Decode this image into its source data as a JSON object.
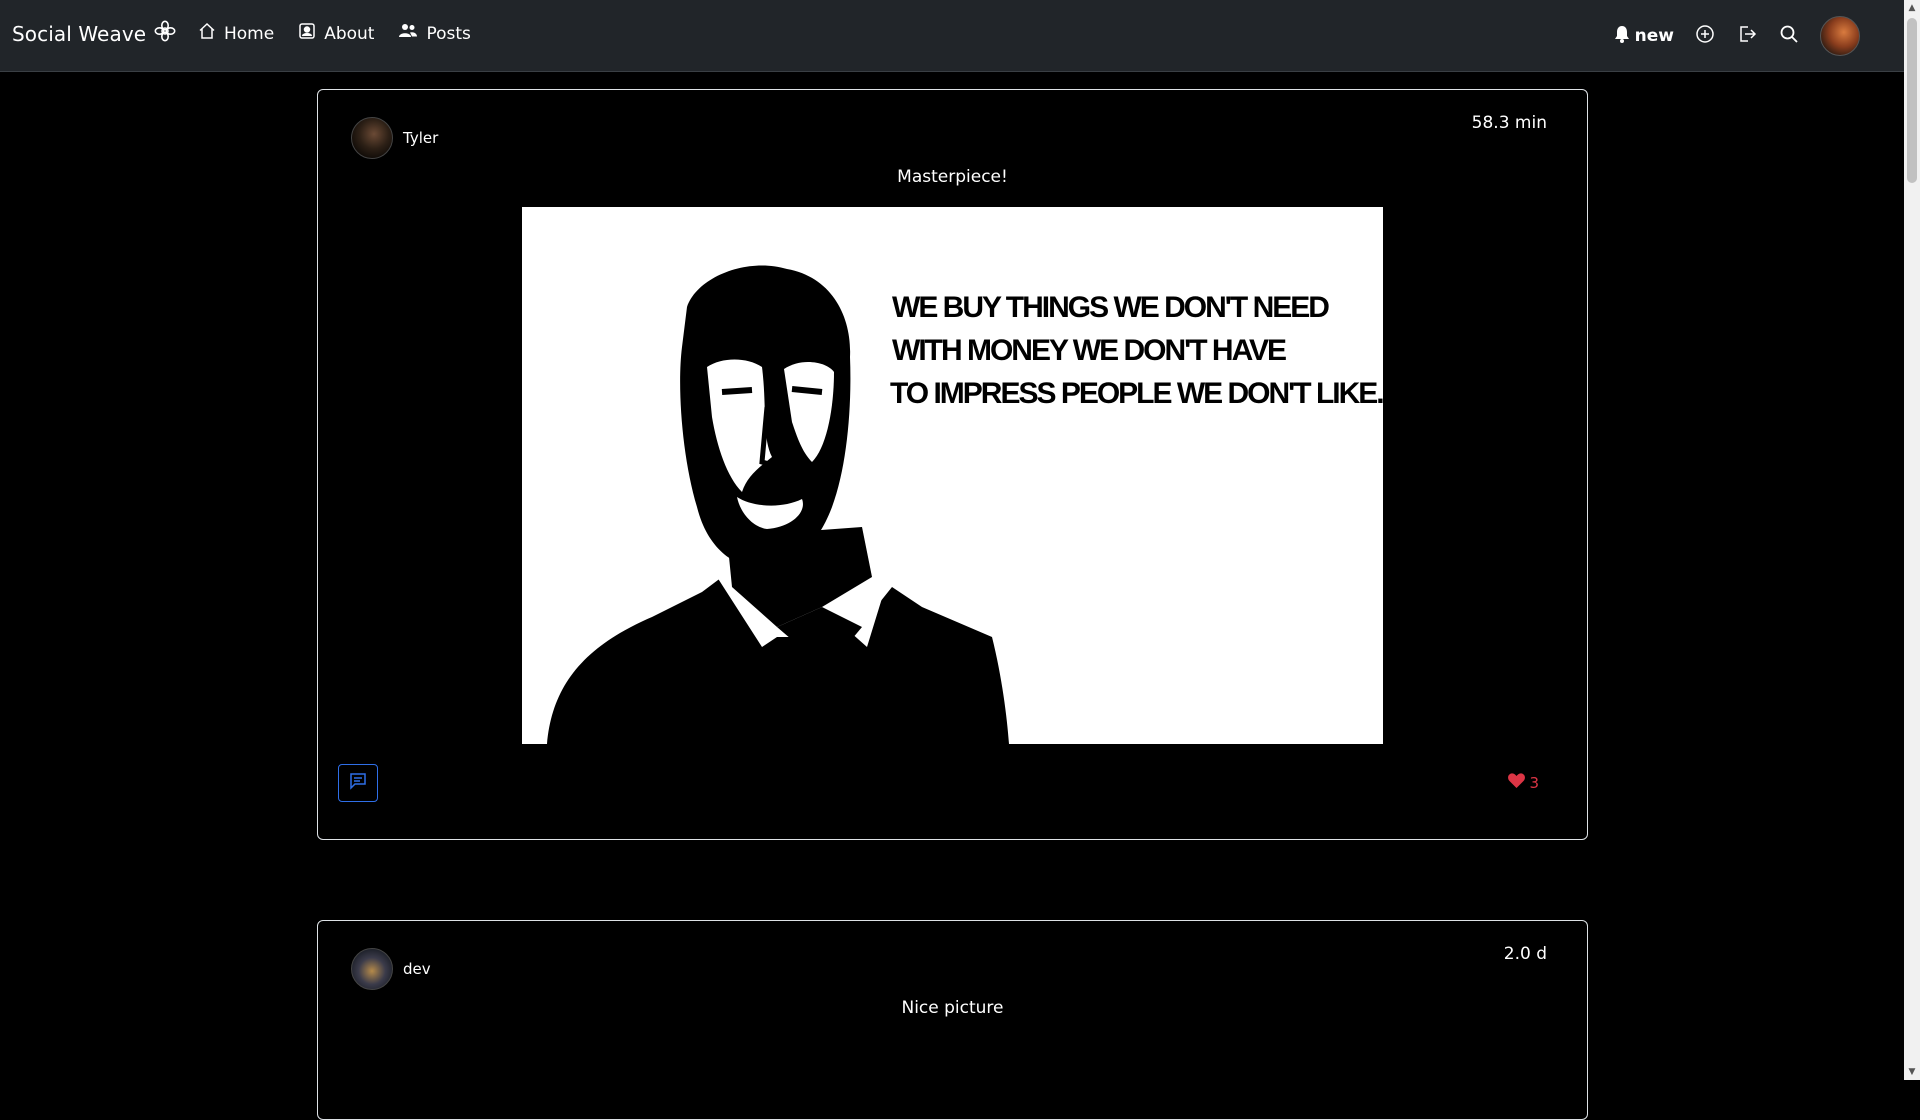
{
  "app": {
    "brand": "Social Weave",
    "brand_icon": "flower-icon"
  },
  "nav": {
    "links": [
      {
        "label": "Home",
        "icon": "house-icon"
      },
      {
        "label": "About",
        "icon": "person-badge-icon"
      },
      {
        "label": "Posts",
        "icon": "people-icon"
      }
    ],
    "notifications_label": "new",
    "right_icons": [
      "bell-icon",
      "plus-circle-icon",
      "logout-icon",
      "search-icon",
      "user-avatar"
    ]
  },
  "posts": [
    {
      "author": "Tyler",
      "time": "58.3 min",
      "caption": "Masterpiece!",
      "image_quote": [
        "WE BUY THINGS WE DON'T NEED",
        "WITH MONEY WE DON'T HAVE",
        "TO IMPRESS PEOPLE WE DON'T LIKE."
      ],
      "likes": "3"
    },
    {
      "author": "dev",
      "time": "2.0 d",
      "caption": "Nice picture"
    }
  ],
  "colors": {
    "navbar_bg": "#212529",
    "page_bg": "#000000",
    "like_red": "#dc3545",
    "comment_blue": "#2f6fe8"
  }
}
